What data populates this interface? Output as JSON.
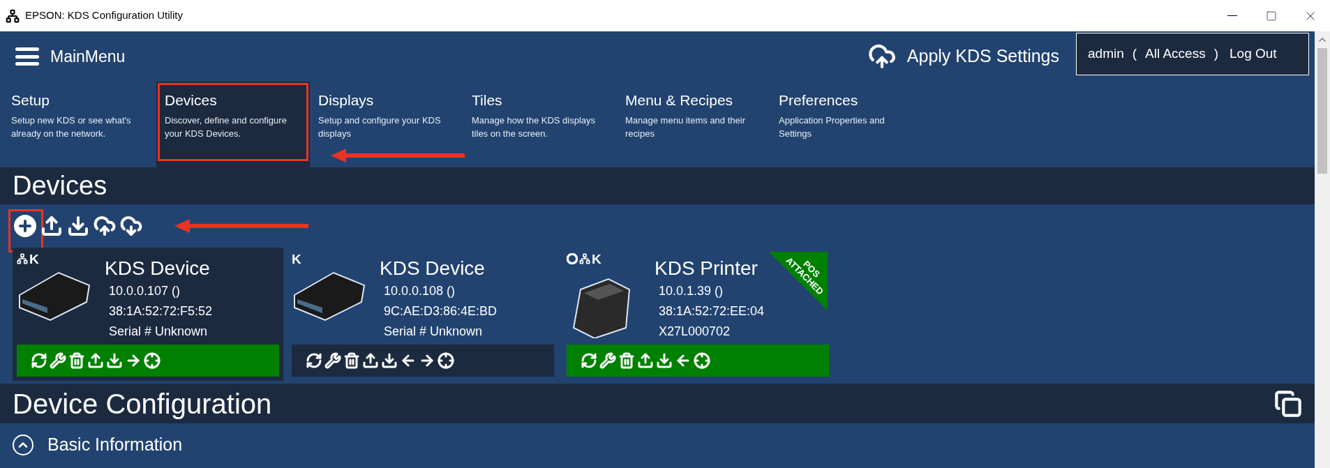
{
  "window": {
    "title": "EPSON: KDS Configuration Utility"
  },
  "header": {
    "menu_label": "MainMenu",
    "apply_label": "Apply KDS Settings",
    "user": "admin",
    "open_paren": "(",
    "access": "All Access",
    "close_paren": ")",
    "logout": "Log Out"
  },
  "tabs": [
    {
      "title": "Setup",
      "description": "Setup new KDS or see what's already on the network.",
      "selected": false,
      "annotated": false
    },
    {
      "title": "Devices",
      "description": "Discover, define and configure your KDS Devices.",
      "selected": true,
      "annotated": true
    },
    {
      "title": "Displays",
      "description": "Setup and configure your KDS displays",
      "selected": false,
      "annotated": false
    },
    {
      "title": "Tiles",
      "description": "Manage how the KDS displays tiles on the screen.",
      "selected": false,
      "annotated": false
    },
    {
      "title": "Menu & Recipes",
      "description": "Manage menu items and their recipes",
      "selected": false,
      "annotated": false
    },
    {
      "title": "Preferences",
      "description": "Application Properties and Settings",
      "selected": false,
      "annotated": false
    }
  ],
  "devices_section": {
    "title": "Devices",
    "toolbar": [
      {
        "kind": "add",
        "annotated": true
      },
      {
        "kind": "upload",
        "annotated": false
      },
      {
        "kind": "download",
        "annotated": false
      },
      {
        "kind": "cloud-upload",
        "annotated": false
      },
      {
        "kind": "cloud-download",
        "annotated": false
      }
    ],
    "cards": [
      {
        "kind": "terminal",
        "badge_icons": [
          {
            "kind": "network"
          }
        ],
        "badge_letter": "K",
        "title": "KDS Device",
        "lines": [
          "10.0.0.107 ()",
          "38:1A:52:72:F5:52",
          "Serial # Unknown"
        ],
        "selected": true,
        "active": true,
        "actions": [
          {
            "kind": "refresh"
          },
          {
            "kind": "wrench"
          },
          {
            "kind": "trash"
          },
          {
            "kind": "upload"
          },
          {
            "kind": "download"
          },
          {
            "kind": "arrow-right"
          },
          {
            "kind": "crosshair"
          }
        ]
      },
      {
        "kind": "terminal",
        "badge_letter": "K",
        "title": "KDS Device",
        "lines": [
          "10.0.0.108 ()",
          "9C:AE:D3:86:4E:BD",
          "Serial # Unknown"
        ],
        "selected": false,
        "active": false,
        "actions": [
          {
            "kind": "refresh"
          },
          {
            "kind": "wrench"
          },
          {
            "kind": "trash"
          },
          {
            "kind": "upload"
          },
          {
            "kind": "download"
          },
          {
            "kind": "arrow-left"
          },
          {
            "kind": "arrow-right"
          },
          {
            "kind": "crosshair"
          }
        ]
      },
      {
        "kind": "printer",
        "badge_icons": [
          {
            "kind": "circle"
          },
          {
            "kind": "network"
          }
        ],
        "badge_letter": "K",
        "title": "KDS Printer",
        "lines": [
          "10.0.1.39 ()",
          "38:1A:52:72:EE:04",
          "X27L000702"
        ],
        "selected": false,
        "active": true,
        "ribbon": [
          "POS",
          "ATTACHED"
        ],
        "actions": [
          {
            "kind": "refresh"
          },
          {
            "kind": "wrench"
          },
          {
            "kind": "trash"
          },
          {
            "kind": "upload"
          },
          {
            "kind": "download"
          },
          {
            "kind": "arrow-left"
          },
          {
            "kind": "crosshair"
          }
        ]
      }
    ]
  },
  "configuration": {
    "title": "Device Configuration",
    "sections": [
      {
        "title": "Basic Information",
        "expanded": true
      }
    ]
  }
}
